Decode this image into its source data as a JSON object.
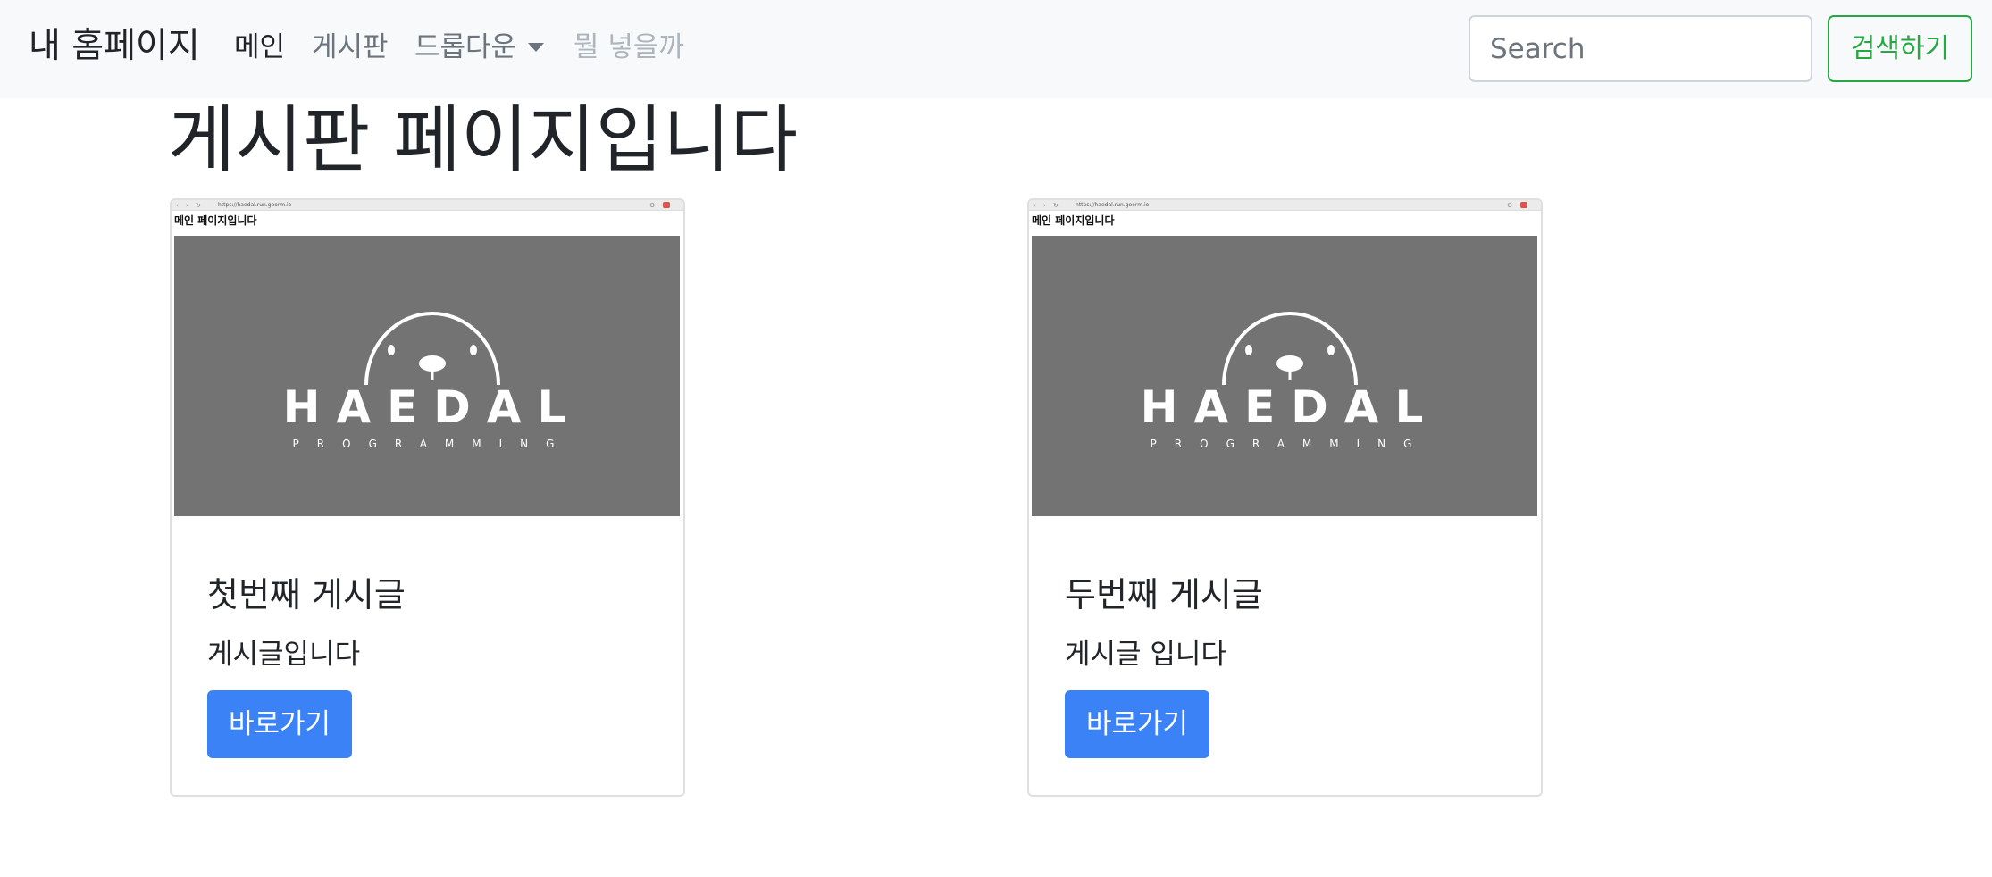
{
  "navbar": {
    "brand": "내 홈페이지",
    "links": {
      "main": "메인",
      "board": "게시판",
      "dropdown": "드롭다운",
      "disabled": "뭘 넣을까"
    },
    "search": {
      "placeholder": "Search",
      "button_label": "검색하기"
    },
    "colors": {
      "background": "#f8f9fa",
      "search_button": "#28a745"
    }
  },
  "page": {
    "title": "게시판 페이지입니다"
  },
  "cards": [
    {
      "thumbnail": {
        "browser_url": "https://haedal.run.goorm.io",
        "heading": "메인 페이지입니다",
        "logo_text": "HAEDAL",
        "logo_subtext": "PROGRAMMING"
      },
      "title": "첫번째 게시글",
      "text": "게시글입니다",
      "button_label": "바로가기"
    },
    {
      "thumbnail": {
        "browser_url": "https://haedal.run.goorm.io",
        "heading": "메인 페이지입니다",
        "logo_text": "HAEDAL",
        "logo_subtext": "PROGRAMMING"
      },
      "title": "두번째 게시글",
      "text": "게시글 입니다",
      "button_label": "바로가기"
    }
  ],
  "colors": {
    "primary_button": "#3b82f6",
    "banner_gray": "#737373"
  },
  "icons": {
    "dropdown": "caret-down-icon",
    "logo": "haedal-seal-logo-icon"
  }
}
